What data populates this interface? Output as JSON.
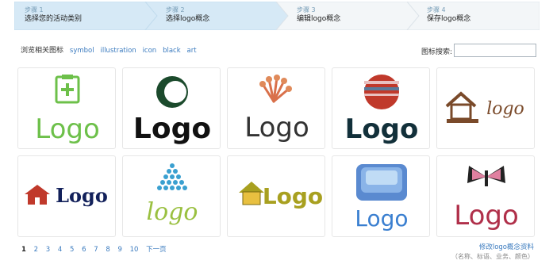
{
  "steps": [
    {
      "num": "步骤 1",
      "title": "选择您的活动类别"
    },
    {
      "num": "步骤 2",
      "title": "选择logo概念"
    },
    {
      "num": "步骤 3",
      "title": "编辑logo概念"
    },
    {
      "num": "步骤 4",
      "title": "保存logo概念"
    }
  ],
  "browse": {
    "label": "浏览相关图标",
    "tags": [
      "symbol",
      "illustration",
      "icon",
      "black",
      "art"
    ]
  },
  "search": {
    "label": "图标搜索:",
    "value": "",
    "placeholder": ""
  },
  "logo_word": "Logo",
  "logo_word_lower": "logo",
  "cards": [
    {
      "icon": "clipboard-plus-icon",
      "color": "#6dc04a"
    },
    {
      "icon": "green-circle-icon",
      "color": "#1b4a2c"
    },
    {
      "icon": "peacock-fan-icon",
      "color": "#d9704a"
    },
    {
      "icon": "striped-sphere-icon",
      "color": "#c0392b"
    },
    {
      "icon": "house-icon",
      "color": "#7a4a2a"
    },
    {
      "icon": "red-house-icon",
      "color": "#c0392b"
    },
    {
      "icon": "dot-triangle-icon",
      "color": "#3aa0d0"
    },
    {
      "icon": "gold-house-icon",
      "color": "#a8a020"
    },
    {
      "icon": "blue-stack-icon",
      "color": "#3a7fd0"
    },
    {
      "icon": "butterfly-icon",
      "color": "#b0304a"
    }
  ],
  "pagination": {
    "pages": [
      "1",
      "2",
      "3",
      "4",
      "5",
      "6",
      "7",
      "8",
      "9",
      "10"
    ],
    "next": "下一页",
    "current": "1"
  },
  "modify": {
    "link": "修改logo概念资料",
    "sub": "（名称、标语、业务、颜色）"
  }
}
